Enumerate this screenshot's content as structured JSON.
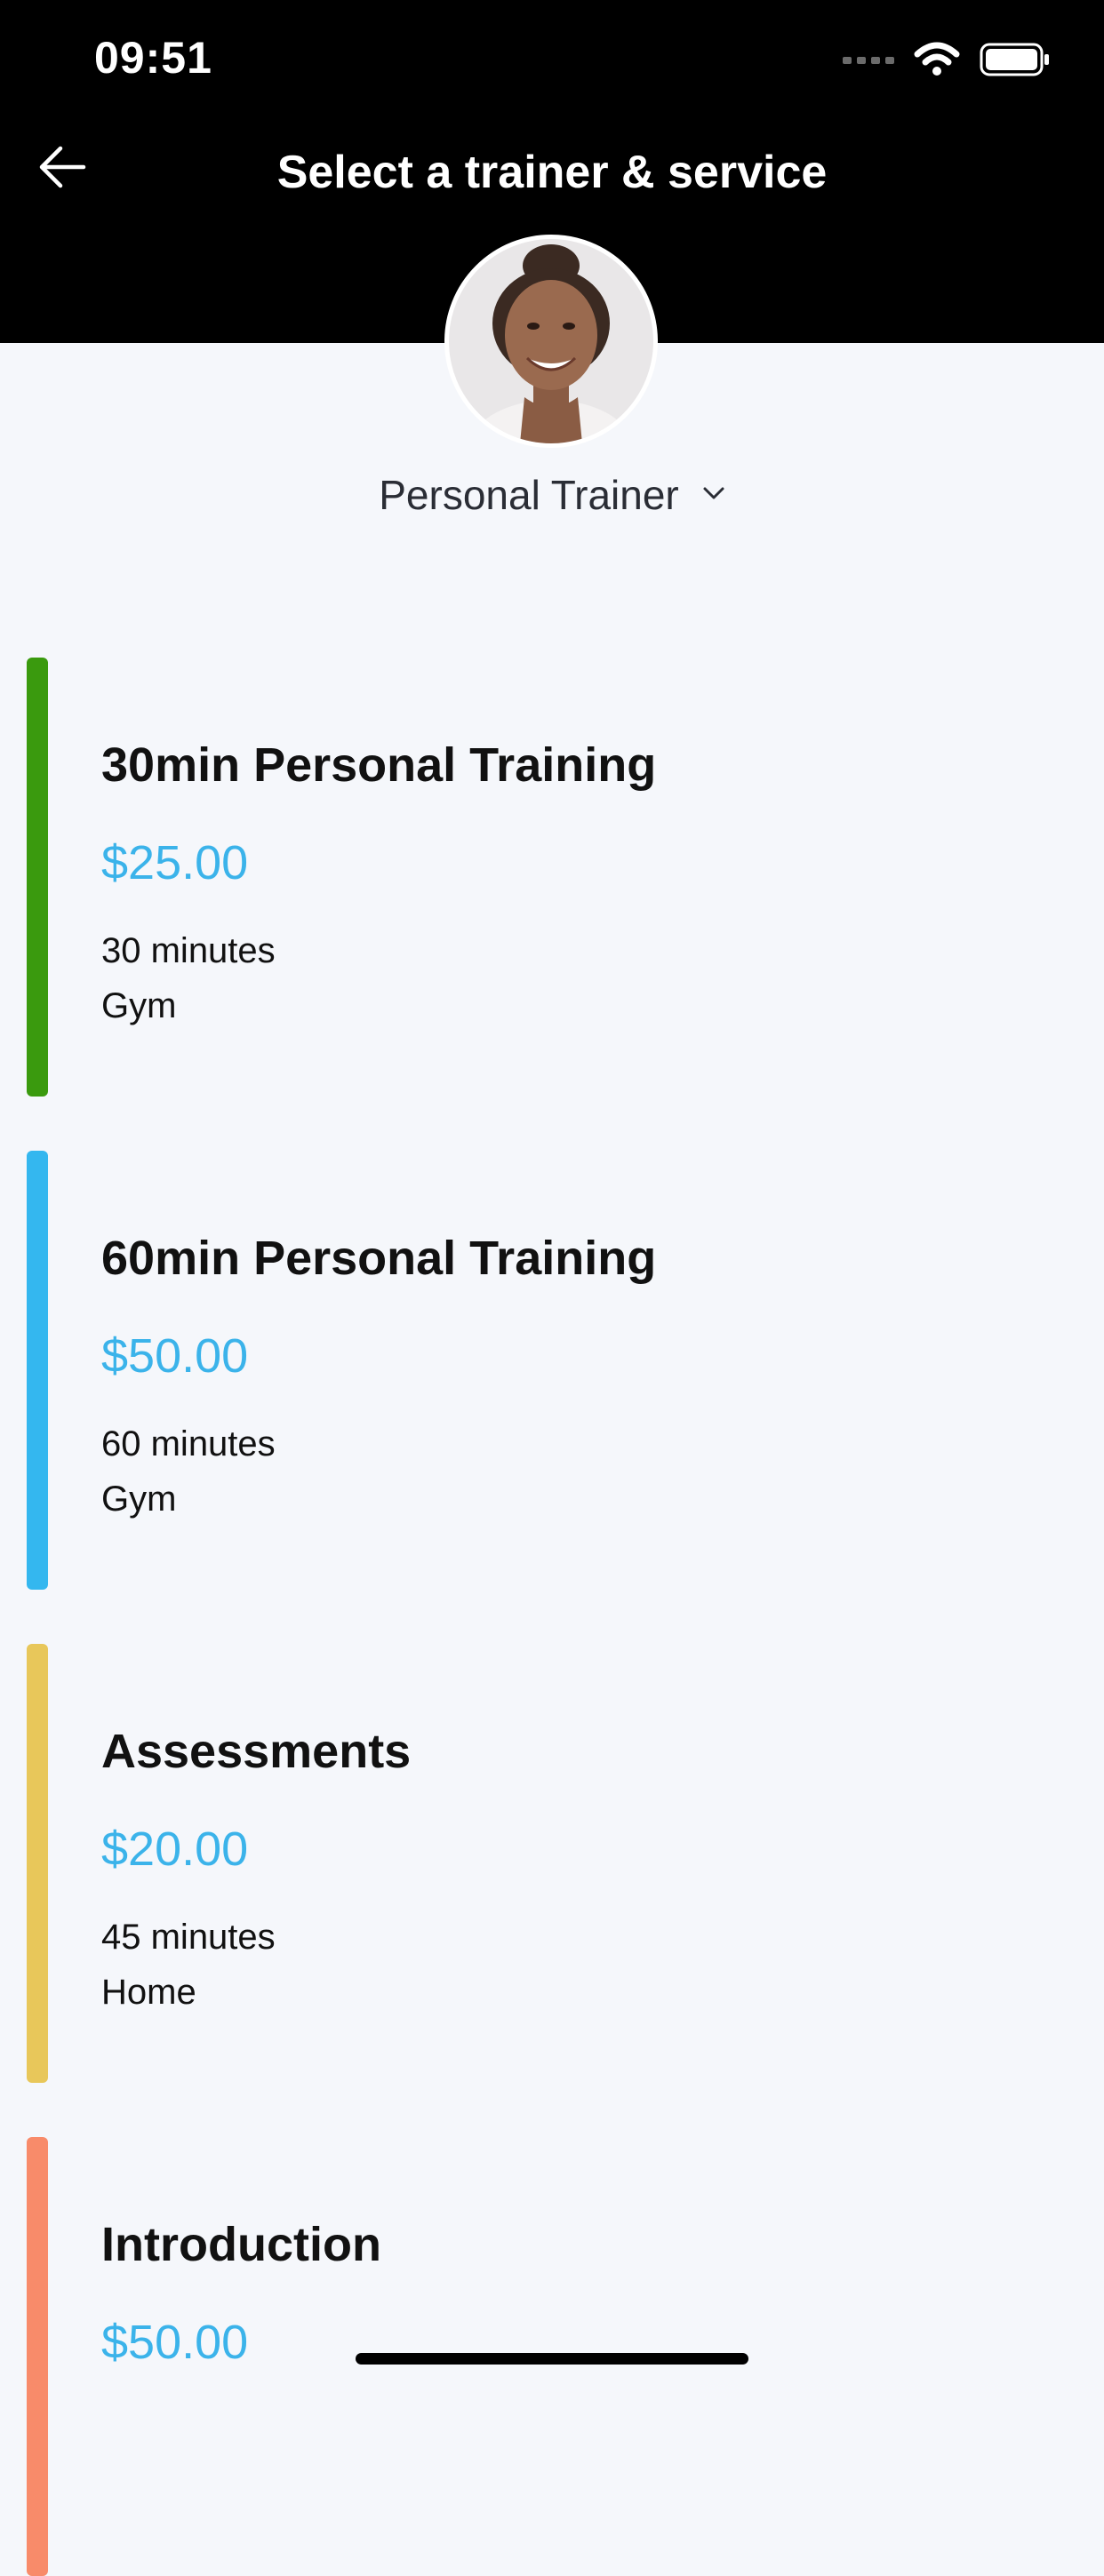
{
  "status_bar": {
    "time": "09:51",
    "icons": [
      "signal-icon",
      "wifi-icon",
      "battery-icon"
    ]
  },
  "header": {
    "title": "Select a trainer & service",
    "back_icon": "back-arrow-icon"
  },
  "trainer": {
    "avatar_icon": "trainer-avatar",
    "name": "Personal Trainer",
    "dropdown_icon": "chevron-down-icon"
  },
  "services": [
    {
      "name": "30min Personal Training",
      "price": "$25.00",
      "duration": "30 minutes",
      "location": "Gym",
      "color": "#3a9a0e"
    },
    {
      "name": "60min Personal Training",
      "price": "$50.00",
      "duration": "60 minutes",
      "location": "Gym",
      "color": "#34b7ef"
    },
    {
      "name": "Assessments",
      "price": "$20.00",
      "duration": "45 minutes",
      "location": "Home",
      "color": "#e8c75a"
    },
    {
      "name": "Introduction",
      "price": "$50.00",
      "duration": "",
      "location": "",
      "color": "#f88b6a"
    }
  ],
  "colors": {
    "header_bg": "#000000",
    "page_bg": "#f5f7fb",
    "price_accent": "#3bb3ea"
  }
}
